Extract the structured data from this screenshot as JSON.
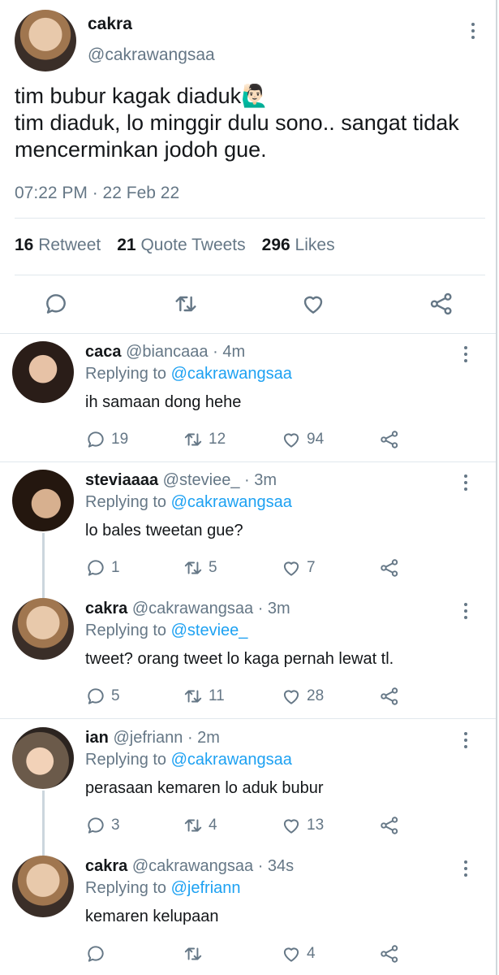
{
  "tweet": {
    "name": "cakra",
    "handle": "@cakrawangsaa",
    "text": "tim bubur kagak diaduk🙋🏻‍♂️\ntim diaduk, lo minggir dulu sono.. sangat tidak mencerminkan jodoh gue.",
    "timestamp": "07:22 PM · 22 Feb 22",
    "retweets": "16",
    "retweets_label": "Retweet",
    "quotes": "21",
    "quotes_label": "Quote Tweets",
    "likes": "296",
    "likes_label": "Likes"
  },
  "replies": [
    {
      "name": "caca",
      "handle": "@biancaaa",
      "age": "· 4m",
      "replying_label": "Replying to",
      "replying_to": "@cakrawangsaa",
      "text": "ih samaan dong hehe",
      "comments": "19",
      "retweets": "12",
      "likes": "94"
    },
    {
      "name": "steviaaaa",
      "handle": "@steviee_",
      "age": "· 3m",
      "replying_label": "Replying to",
      "replying_to": "@cakrawangsaa",
      "text": "lo bales tweetan gue?",
      "comments": "1",
      "retweets": "5",
      "likes": "7"
    },
    {
      "name": "cakra",
      "handle": "@cakrawangsaa",
      "age": "· 3m",
      "replying_label": "Replying to",
      "replying_to": "@steviee_",
      "text": "tweet? orang tweet lo kaga pernah lewat tl.",
      "comments": "5",
      "retweets": "11",
      "likes": "28"
    },
    {
      "name": "ian",
      "handle": "@jefriann",
      "age": "· 2m",
      "replying_label": "Replying to",
      "replying_to": "@cakrawangsaa",
      "text": "perasaan kemaren lo aduk bubur",
      "comments": "3",
      "retweets": "4",
      "likes": "13"
    },
    {
      "name": "cakra",
      "handle": "@cakrawangsaa",
      "age": "· 34s",
      "replying_label": "Replying to",
      "replying_to": "@jefriann",
      "text": "kemaren kelupaan",
      "comments": "",
      "retweets": "",
      "likes": "4"
    }
  ],
  "colors": {
    "accent": "#1da1f2",
    "muted": "#657786",
    "divider": "#e1e8ed"
  },
  "icons": [
    "reply-icon",
    "retweet-icon",
    "like-icon",
    "share-icon",
    "more-icon"
  ]
}
